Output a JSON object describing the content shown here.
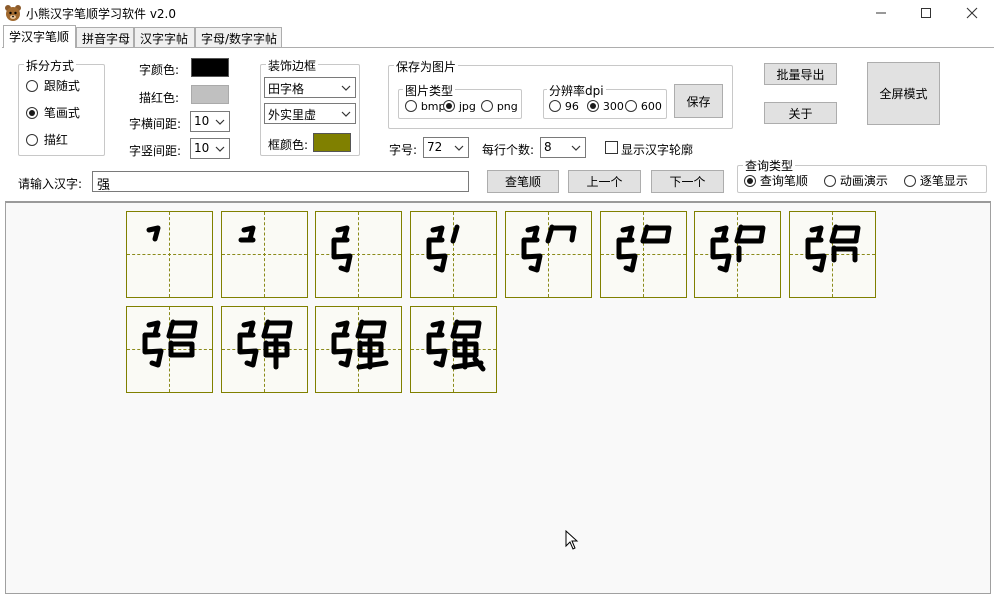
{
  "window": {
    "title": "小熊汉字笔顺学习软件 v2.0",
    "icon": "bear-icon",
    "controls": [
      "minimize-icon",
      "maximize-icon",
      "close-icon"
    ]
  },
  "tabs": [
    {
      "label": "学汉字笔顺",
      "active": true
    },
    {
      "label": "拼音字母",
      "active": false
    },
    {
      "label": "汉字字帖",
      "active": false
    },
    {
      "label": "字母/数字字帖",
      "active": false
    }
  ],
  "split_mode": {
    "legend": "拆分方式",
    "options": [
      {
        "label": "跟随式",
        "selected": false
      },
      {
        "label": "笔画式",
        "selected": true
      },
      {
        "label": "描红",
        "selected": false
      }
    ]
  },
  "style": {
    "font_color_label": "字颜色:",
    "font_color": "#000000",
    "trace_color_label": "描红色:",
    "trace_color": "#c0c0c0",
    "h_spacing_label": "字横间距:",
    "h_spacing": "10",
    "v_spacing_label": "字竖间距:",
    "v_spacing": "10"
  },
  "border": {
    "legend": "装饰边框",
    "grid_type": "田字格",
    "line_style": "外实里虚",
    "frame_color_label": "框颜色:",
    "frame_color": "#808000"
  },
  "save": {
    "legend": "保存为图片",
    "image_type_legend": "图片类型",
    "image_types": [
      {
        "label": "bmp",
        "selected": false
      },
      {
        "label": "jpg",
        "selected": true
      },
      {
        "label": "png",
        "selected": false
      }
    ],
    "dpi_legend": "分辨率dpi",
    "dpis": [
      {
        "label": "96",
        "selected": false
      },
      {
        "label": "300",
        "selected": true
      },
      {
        "label": "600",
        "selected": false
      }
    ],
    "save_button": "保存"
  },
  "size_row": {
    "font_size_label": "字号:",
    "font_size": "72",
    "per_row_label": "每行个数:",
    "per_row": "8",
    "outline_label": "显示汉字轮廓",
    "outline_checked": false
  },
  "right_buttons": {
    "batch_export": "批量导出",
    "about": "关于",
    "fullscreen": "全屏模式"
  },
  "input_row": {
    "label": "请输入汉字:",
    "value": "强",
    "search": "查笔顺",
    "prev": "上一个",
    "next": "下一个"
  },
  "query_type": {
    "legend": "查询类型",
    "options": [
      {
        "label": "查询笔顺",
        "selected": true
      },
      {
        "label": "动画演示",
        "selected": false
      },
      {
        "label": "逐笔显示",
        "selected": false
      }
    ]
  },
  "strokes": {
    "character": "强",
    "stroke_count": 12,
    "frame_color": "#808000",
    "ink_color": "#000000"
  }
}
